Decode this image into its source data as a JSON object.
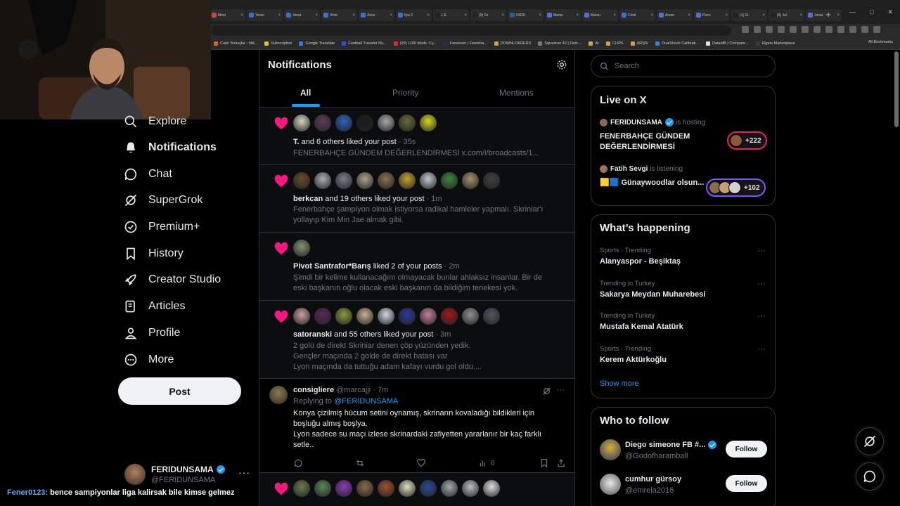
{
  "browser": {
    "tabs": [
      {
        "title": "Most",
        "color": "#d0463a"
      },
      {
        "title": "Yeren",
        "color": "#3a6fd0"
      },
      {
        "title": "Jonat",
        "color": "#3a6fd0"
      },
      {
        "title": "Victo",
        "color": "#3a6fd0"
      },
      {
        "title": "Zeno",
        "color": "#3a6fd0"
      },
      {
        "title": "Ilya Z",
        "color": "#3a6fd0"
      },
      {
        "title": "L'É",
        "color": "#222222"
      },
      {
        "title": "(5) Fe",
        "color": "#222222"
      },
      {
        "title": "FM26",
        "color": "#2a5b9a"
      },
      {
        "title": "Mamu",
        "color": "#5a6bd8"
      },
      {
        "title": "Mamu",
        "color": "#5a6bd8"
      },
      {
        "title": "Cristi",
        "color": "#3a6fd0"
      },
      {
        "title": "Arsen",
        "color": "#5a6bd8"
      },
      {
        "title": "Piero",
        "color": "#5a6bd8"
      },
      {
        "title": "(1) Gi",
        "color": "#222222"
      },
      {
        "title": "(4) Jai",
        "color": "#222222"
      },
      {
        "title": "Jonat",
        "color": "#5a6bd8"
      }
    ],
    "new_tab": "+",
    "window_controls": [
      "—",
      "□",
      "✕"
    ],
    "bookmarks": [
      {
        "label": "Canlı Sonuçlar - İdd...",
        "color": "#e05a2a"
      },
      {
        "label": "Subscription",
        "color": "#e0c02a"
      },
      {
        "label": "Google Translate",
        "color": "#3a7ae0"
      },
      {
        "label": "Football Transfer Ru...",
        "color": "#3a4ae0"
      },
      {
        "label": "(29) 1100 Mods. Cy...",
        "color": "#e02a2a"
      },
      {
        "label": "Fenerium | Fenerba...",
        "color": "#2a2a5a"
      },
      {
        "label": "DOWNLOADERS",
        "color": "#c9a24a"
      },
      {
        "label": "Squadron 42 | First-...",
        "color": "#7a7a7a"
      },
      {
        "label": "AI",
        "color": "#c9a24a"
      },
      {
        "label": "CLIPS",
        "color": "#c9a24a"
      },
      {
        "label": "ARŞİV",
        "color": "#c9a24a"
      },
      {
        "label": "DualShock Calibrati...",
        "color": "#3a7ae0"
      },
      {
        "label": "DataMB | Compare...",
        "color": "#e0e0e0"
      },
      {
        "label": "Elgato Marketplace",
        "color": "#3a3a3a"
      }
    ],
    "all_bookmarks": "All Bookmarks"
  },
  "nav": {
    "items": [
      {
        "label": "Explore",
        "icon": "search-icon"
      },
      {
        "label": "Notifications",
        "icon": "bell-icon"
      },
      {
        "label": "Chat",
        "icon": "chat-icon"
      },
      {
        "label": "SuperGrok",
        "icon": "grok-icon"
      },
      {
        "label": "Premium+",
        "icon": "premium-icon"
      },
      {
        "label": "History",
        "icon": "bookmark-icon"
      },
      {
        "label": "Creator Studio",
        "icon": "rocket-icon"
      },
      {
        "label": "Articles",
        "icon": "articles-icon"
      },
      {
        "label": "Profile",
        "icon": "person-icon"
      },
      {
        "label": "More",
        "icon": "more-circle-icon"
      }
    ],
    "post_label": "Post",
    "account": {
      "name": "FERIDUNSAMA",
      "handle": "@FERIDUNSAMA",
      "more": "···"
    }
  },
  "overlay": {
    "user": "Fener0123:",
    "message": "bence sampiyonlar liga kalirsak bile kimse gelmez"
  },
  "main": {
    "title": "Notifications",
    "tabs": [
      "All",
      "Priority",
      "Mentions"
    ],
    "notifications": [
      {
        "avatars": [
          "#d8d3c0",
          "#5a3f5a",
          "#2a64c0",
          "#1a1a1a",
          "#a8a8a8",
          "#6a6a3a",
          "#d8d820"
        ],
        "actor": "T.",
        "text": " and 6 others liked your post",
        "time": " · 35s",
        "lines": [
          "FENERBAHÇE GÜNDEM DEĞERLENDİRMESİ x.com/i/broadcasts/1..."
        ]
      },
      {
        "avatars": [
          "#6a4a2a",
          "#a8b0b8",
          "#7a8088",
          "#b0a090",
          "#8a7050",
          "#c8a030",
          "#c0c8d0",
          "#3a8a3a",
          "#a89070",
          "#404040"
        ],
        "actor": "berkcan",
        "text": " and 19 others liked your post",
        "time": " · 1m",
        "lines": [
          "Fenerbahçe şampiyon olmak istiyorsa radikal hamleler yapmalı. Skriniar'ı",
          "yollayıp Kim Min Jae almak gibi."
        ]
      },
      {
        "avatars": [
          "#8a9070"
        ],
        "actor": "Pivot Santrafor*Barış",
        "text": " liked 2 of your posts",
        "time": " · 2m",
        "lines": [
          "Şimdi bir kelime kullanacağım olmayacak bunlar ahlaksız insanlar. Bir de",
          "eski başkanın oğlu olacak eski başkanın da bildiğim tenekesi yok."
        ]
      },
      {
        "avatars": [
          "#c8a0a0",
          "#5a2a5a",
          "#8a9a3a",
          "#c8b090",
          "#d0d8e0",
          "#2a3a9a",
          "#c080a0",
          "#a01818",
          "#909090",
          "#505860"
        ],
        "actor": "satoranski",
        "text": " and 55 others liked your post",
        "time": " · 3m",
        "lines": [
          "2 golü de direkt Skriniar denen çöp yüzünden yedik.",
          "Gençler maçında 2 golde de direkt hatası var",
          "Lyon maçında da tuttuğu adam kafayı vurdu gol oldu...."
        ]
      }
    ],
    "reply": {
      "name": "consigliere",
      "handle": " @marcajji",
      "time": " · 7m",
      "replying_to": "Replying to ",
      "replying_handle": "@FERIDUNSAMA",
      "lines": [
        "Konya çizilmiş hücum setini oynamış, skrinarın kovaladığı bildikleri için",
        "boşluğu almış boşlya.",
        "Lyon sadece su maçı izlese skrinardaki zafiyetten yararlanır bir kaç farklı",
        "setle.."
      ],
      "views": "6",
      "more": "···"
    },
    "last_notification": {
      "avatars": [
        "#6a7a4a",
        "#5a8a5a",
        "#8a3ac0",
        "#8a6a4a",
        "#a05030",
        "#e0e0c0",
        "#2a4a9a",
        "#a0a8b0",
        "#b8c0c8",
        "#e0e0e0"
      ]
    }
  },
  "right": {
    "search_placeholder": "Search",
    "live": {
      "title": "Live on X",
      "entries": [
        {
          "host": "FERIDUNSAMA",
          "activity": "is hosting",
          "title": "FENERBAHÇE GÜNDEM DEĞERLENDİRMESİ",
          "count": "+222",
          "pill_color": "#e0245e"
        },
        {
          "host": "Fatih Sevgi",
          "activity": "is listening",
          "title": "🟨🟦 Günaywoodlar olsun...",
          "count": "+102",
          "pill_color": "#7856ff"
        }
      ]
    },
    "happening": {
      "title": "What’s happening",
      "trends": [
        {
          "category": "Sports · Trending",
          "name": "Alanyaspor - Beşiktaş"
        },
        {
          "category": "Trending in Turkey",
          "name": "Sakarya Meydan Muharebesi"
        },
        {
          "category": "Trending in Turkey",
          "name": "Mustafa Kemal Atatürk"
        },
        {
          "category": "Sports · Trending",
          "name": "Kerem Aktürkoğlu"
        }
      ],
      "more": "···",
      "show_more": "Show more"
    },
    "who_to_follow": {
      "title": "Who to follow",
      "accounts": [
        {
          "name": "Diego simeone FB #...",
          "handle": "@Godofharamball",
          "verified": true,
          "follow": "Follow"
        },
        {
          "name": "cumhur gürsoy",
          "handle": "@emrela2016",
          "verified": false,
          "follow": "Follow"
        }
      ]
    }
  }
}
